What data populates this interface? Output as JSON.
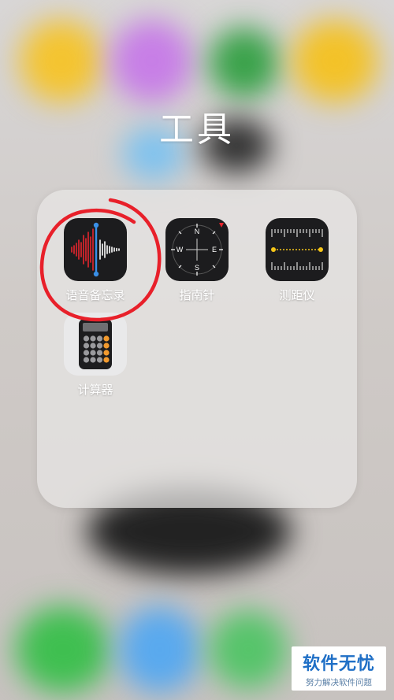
{
  "folder": {
    "title": "工具",
    "apps": [
      {
        "label": "语音备忘录",
        "icon": "voice-memos-waveform-icon"
      },
      {
        "label": "指南针",
        "icon": "compass-icon"
      },
      {
        "label": "测距仪",
        "icon": "measure-ruler-icon"
      },
      {
        "label": "计算器",
        "icon": "calculator-icon"
      }
    ],
    "compass_letters": {
      "n": "N",
      "e": "E",
      "s": "S",
      "w": "W"
    }
  },
  "watermark": {
    "title": "软件无忧",
    "subtitle": "努力解决软件问题"
  },
  "colors": {
    "annotation": "#e8202a",
    "voice_wave_red": "#e8252d",
    "voice_line_blue": "#3a8fe6",
    "measure_yellow": "#f5c518"
  }
}
